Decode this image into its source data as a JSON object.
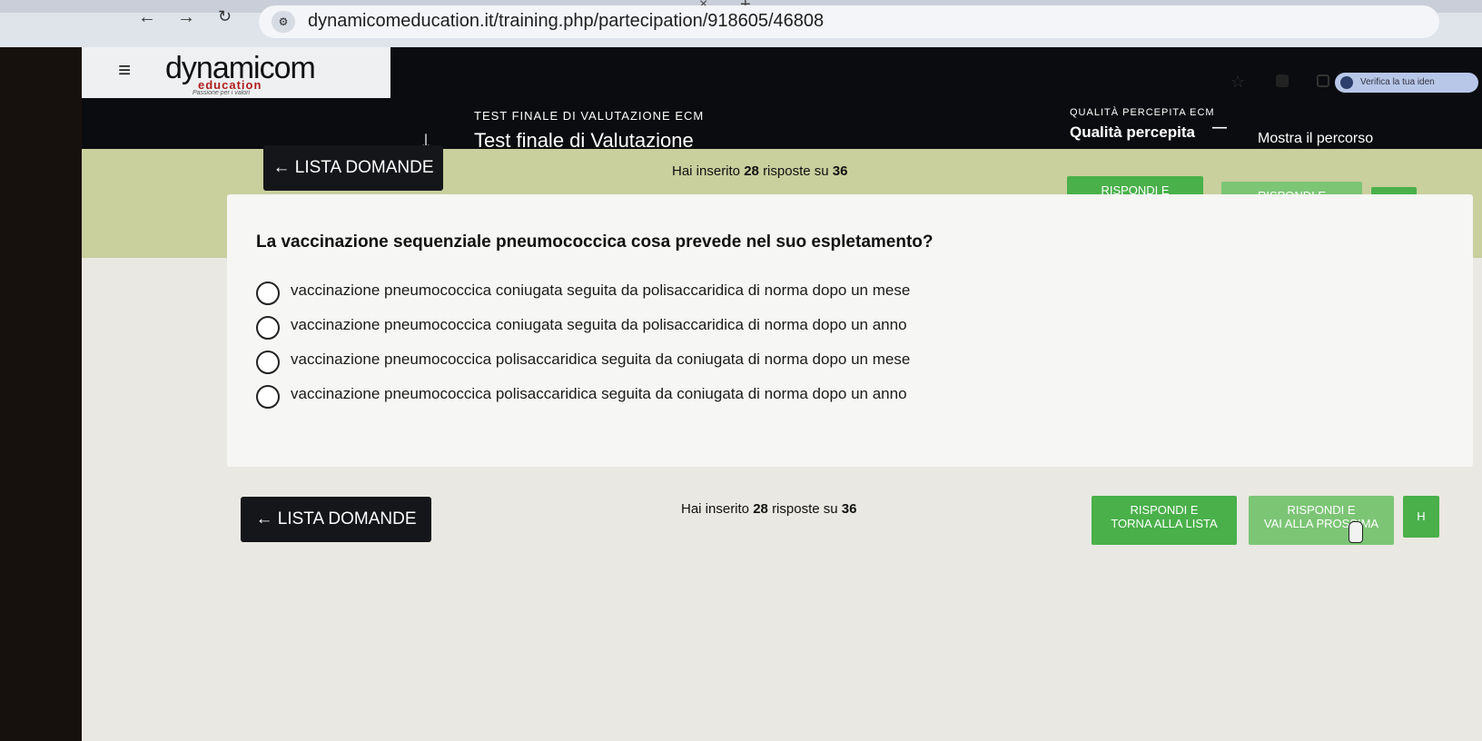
{
  "browser": {
    "url": "dynamicomeducation.it/training.php/partecipation/918605/46808",
    "profile_label": "Verifica la tua iden",
    "icons": [
      "back-icon",
      "forward-icon",
      "reload-icon",
      "site-settings-icon",
      "star-icon",
      "close-tab-icon",
      "new-tab-icon"
    ]
  },
  "logo": {
    "main": "dynamicom",
    "sub": "education",
    "tagline": "Passione per i valori"
  },
  "header": {
    "test_small": "TEST FINALE DI VALUTAZIONE ECM",
    "test_title": "Test finale di Valutazione",
    "quality_small": "QUALITÀ PERCEPITA ECM",
    "quality_title": "Qualità percepita",
    "dash": "—",
    "path_label": "Mostra il percorso"
  },
  "toolbar": {
    "back_to_list": "LISTA DOMANDE",
    "answered_prefix": "Hai inserito",
    "answered_count": "28",
    "answered_middle": "risposte su",
    "answered_total": "36",
    "answer_back_line1": "RISPONDI E",
    "answer_back_line2": "TORNA ALLA LISTA",
    "answer_next_line1": "RISPONDI E",
    "answer_next_line2": "VAI ALLA PROSSIMA",
    "help": "HELP",
    "help_short": "H"
  },
  "question": {
    "text": "La vaccinazione sequenziale pneumococcica cosa prevede nel suo espletamento?",
    "options": [
      {
        "label": "vaccinazione pneumococcica coniugata seguita da polisaccaridica di norma dopo un mese",
        "selected": false
      },
      {
        "label": "vaccinazione pneumococcica coniugata seguita da polisaccaridica di norma dopo un anno",
        "selected": false
      },
      {
        "label": "vaccinazione pneumococcica polisaccaridica seguita da coniugata di norma dopo un mese",
        "selected": false
      },
      {
        "label": "vaccinazione pneumococcica polisaccaridica seguita da coniugata di norma dopo un anno",
        "selected": false
      }
    ]
  },
  "colors": {
    "header_bg": "#0b0c0f",
    "progress_bg": "#c9cf9d",
    "primary_button": "#49b04a",
    "dark_button": "#15161a"
  }
}
